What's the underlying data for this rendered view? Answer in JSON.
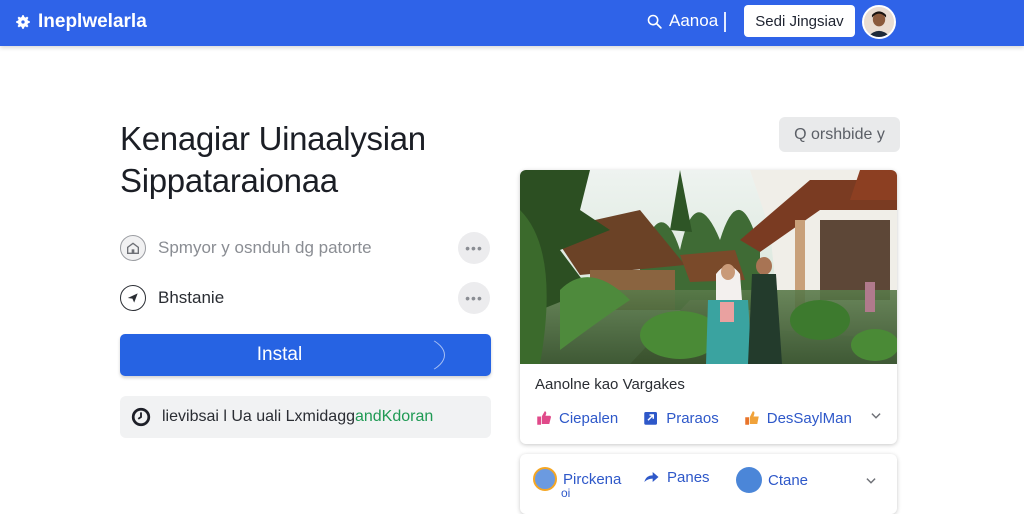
{
  "topbar": {
    "brand": "Ineplwelarla",
    "search_label": "Aanoa",
    "signin_label": "Sedi Jingsiav",
    "accent_color": "#2f63e8"
  },
  "main": {
    "heading_line1": "Kenagiar Uinaalysian",
    "heading_line2": "Sippataraionaa",
    "rows": [
      {
        "icon": "home-icon",
        "label": "Spmyor y osnduh dg patorte"
      },
      {
        "icon": "send-icon",
        "label": "Bhstanie"
      }
    ],
    "install_label": "Instal",
    "info_text": "lievibsai l Ua uali Lxmidagg ",
    "info_highlight": "andKdoran"
  },
  "side": {
    "search_chip": "Q orshbide y",
    "card": {
      "caption": "Aanolne kao Vargakes",
      "actions": [
        {
          "icon": "thumbs-up-icon",
          "label": "Ciepalen"
        },
        {
          "icon": "share-square-icon",
          "label": "Praraos"
        },
        {
          "icon": "like-icon",
          "label": "DesSaylMan"
        }
      ]
    },
    "card2": {
      "items": [
        {
          "icon": "avatar",
          "label": "Pirckena",
          "sub": "oi"
        },
        {
          "icon": "share-arrow-icon",
          "label": "Panes"
        },
        {
          "icon": "avatar",
          "label": "Ctane"
        }
      ]
    }
  }
}
